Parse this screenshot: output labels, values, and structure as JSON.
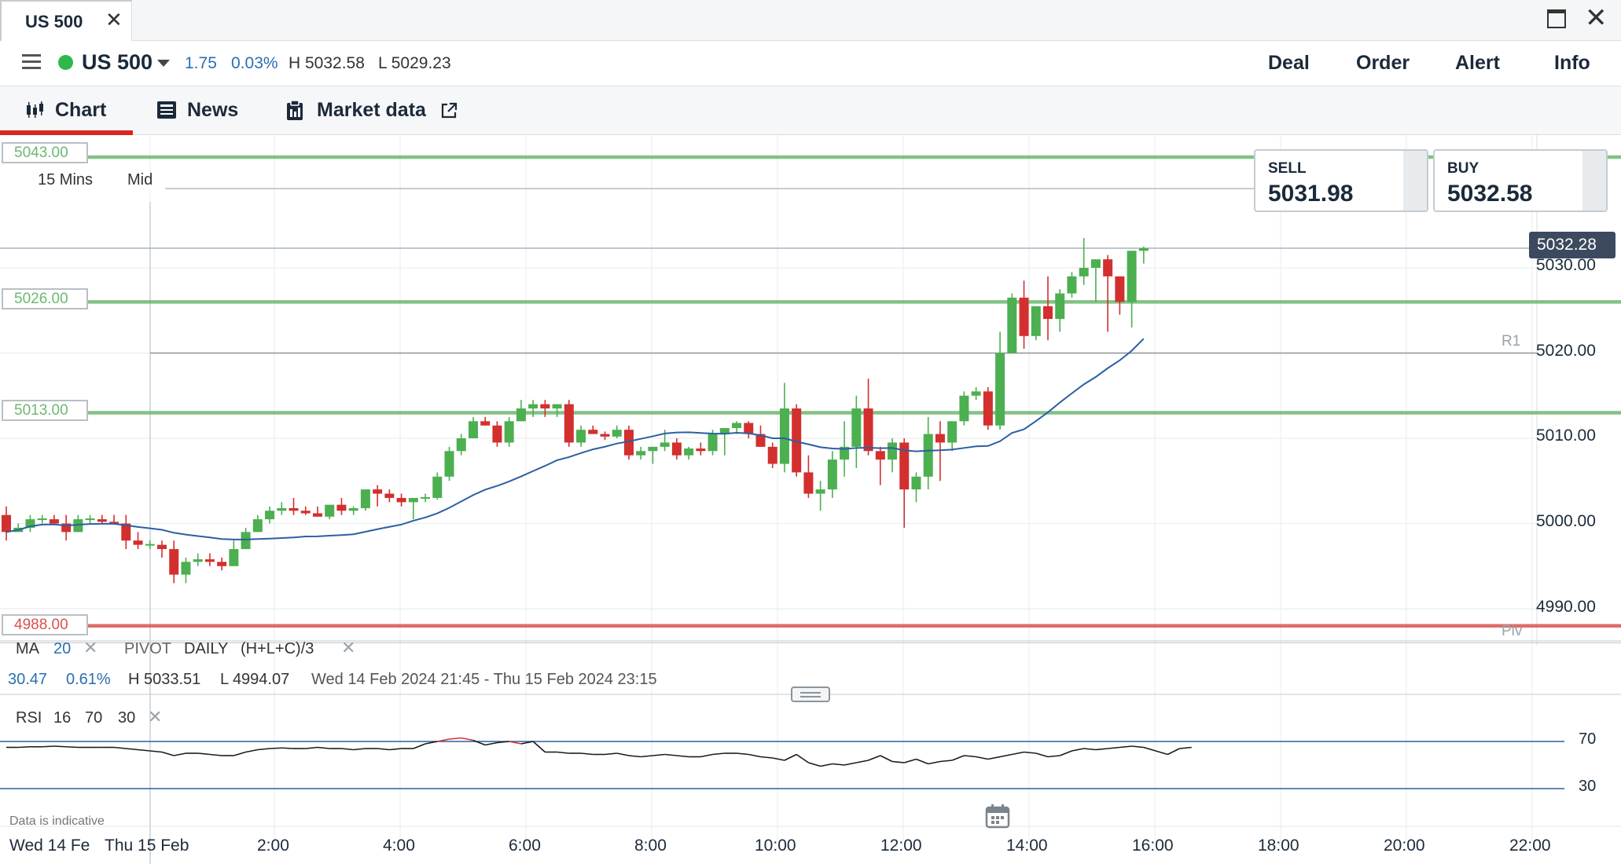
{
  "window": {
    "tab_title": "US 500"
  },
  "header": {
    "instrument": "US 500",
    "change": "1.75",
    "change_pct": "0.03%",
    "high": "H 5032.58",
    "low": "L 5029.23",
    "nav": [
      "Deal",
      "Order",
      "Alert",
      "Info"
    ]
  },
  "subtabs": {
    "chart": "Chart",
    "news": "News",
    "market_data": "Market data"
  },
  "chart": {
    "timeframe": "15 Mins",
    "price_type": "Mid",
    "levels": [
      {
        "label": "5043.00",
        "color": "#6db86f"
      },
      {
        "label": "5026.00",
        "color": "#6db86f"
      },
      {
        "label": "5013.00",
        "color": "#6db86f"
      },
      {
        "label": "4988.00",
        "color": "#d9534f"
      }
    ],
    "sell_label": "SELL",
    "sell_price": "5031.98",
    "buy_label": "BUY",
    "buy_price": "5032.58",
    "current_price": "5032.28",
    "y_axis": [
      "5030.00",
      "5020.00",
      "5010.00",
      "5000.00",
      "4990.00"
    ],
    "r1_label": "R1",
    "piv_label": "Piv",
    "x_axis": [
      "Wed 14 Fe",
      "Thu 15 Feb",
      "2:00",
      "4:00",
      "6:00",
      "8:00",
      "10:00",
      "12:00",
      "14:00",
      "16:00",
      "18:00",
      "20:00",
      "22:00"
    ],
    "indicator_legend": {
      "ma": "MA",
      "ma_period": "20",
      "pivot": "PIVOT",
      "pivot_period": "DAILY",
      "pivot_formula": "(H+L+C)/3"
    },
    "stats": {
      "change": "30.47",
      "change_pct": "0.61%",
      "high": "H 5033.51",
      "low": "L 4994.07",
      "range": "Wed 14 Feb 2024 21:45 - Thu 15 Feb 2024 23:15"
    },
    "rsi": {
      "label": "RSI",
      "period": "16",
      "upper": "70",
      "lower": "30",
      "axis": [
        "70",
        "30"
      ]
    },
    "disclaimer": "Data is indicative",
    "up_color": "#4caf50",
    "down_color": "#d32f2f"
  },
  "chart_data": {
    "type": "candlestick",
    "timeframe": "15 Mins",
    "ylim": [
      4986,
      5046
    ],
    "x_ticks": [
      "2:00",
      "4:00",
      "6:00",
      "8:00",
      "10:00",
      "12:00",
      "14:00",
      "16:00",
      "18:00",
      "20:00",
      "22:00"
    ],
    "candles_ohlc": [
      [
        5001,
        4998,
        5002,
        4999
      ],
      [
        4999,
        4999,
        5000,
        4999.5
      ],
      [
        4999.5,
        4999,
        5001,
        5000.5
      ],
      [
        5000.5,
        5000,
        5001,
        5000.5
      ],
      [
        5000.5,
        5000,
        5001,
        5000
      ],
      [
        5000,
        4998,
        5001,
        4999
      ],
      [
        4999,
        4999,
        5001,
        5000.5
      ],
      [
        5000.5,
        5000,
        5001,
        5000.5
      ],
      [
        5000.5,
        5000,
        5001,
        5000.2
      ],
      [
        5000.2,
        5000,
        5001,
        5000
      ],
      [
        5000,
        4997,
        5001,
        4998
      ],
      [
        4998,
        4997,
        4999,
        4997.5
      ],
      [
        4997.5,
        4997,
        4998,
        4997.5
      ],
      [
        4997.5,
        4996,
        4998,
        4997
      ],
      [
        4997,
        4993,
        4998,
        4994
      ],
      [
        4994,
        4993,
        4996,
        4995.5
      ],
      [
        4995.5,
        4995,
        4996.5,
        4995.8
      ],
      [
        4995.8,
        4995,
        4996.5,
        4995.5
      ],
      [
        4995.5,
        4994.5,
        4996,
        4995
      ],
      [
        4995,
        4995,
        4998,
        4997
      ],
      [
        4997,
        4997,
        4999.5,
        4999
      ],
      [
        4999,
        4999,
        5001,
        5000.5
      ],
      [
        5000.5,
        5000,
        5002,
        5001.5
      ],
      [
        5001.5,
        5001,
        5002.5,
        5001.8
      ],
      [
        5001.8,
        5001,
        5003,
        5001.5
      ],
      [
        5001.5,
        5001,
        5002,
        5001.2
      ],
      [
        5001.2,
        5001,
        5002,
        5000.8
      ],
      [
        5000.8,
        5000.5,
        5002,
        5002.2
      ],
      [
        5002.2,
        5001,
        5003,
        5001.5
      ],
      [
        5001.5,
        5001,
        5002,
        5001.8
      ],
      [
        5001.8,
        5001.5,
        5003.5,
        5004
      ],
      [
        5004,
        5002,
        5004.5,
        5003.5
      ],
      [
        5003.5,
        5002.5,
        5004,
        5003
      ],
      [
        5003,
        5002,
        5003.5,
        5002.5
      ],
      [
        5002.5,
        5000.5,
        5003,
        5003
      ],
      [
        5003,
        5002.5,
        5003.5,
        5003
      ],
      [
        5003,
        5002.8,
        5006,
        5005.5
      ],
      [
        5005.5,
        5005,
        5009,
        5008.5
      ],
      [
        5008.5,
        5008,
        5010.5,
        5010
      ],
      [
        5010,
        5010,
        5012.5,
        5012
      ],
      [
        5012,
        5011.5,
        5012.5,
        5011.5
      ],
      [
        5011.5,
        5009,
        5012,
        5009.5
      ],
      [
        5009.5,
        5009,
        5012.5,
        5012
      ],
      [
        5012,
        5012,
        5014.5,
        5013.5
      ],
      [
        5013.5,
        5012.5,
        5014.5,
        5014
      ],
      [
        5014,
        5012.5,
        5014.5,
        5013.5
      ],
      [
        5013.5,
        5012.5,
        5014,
        5014
      ],
      [
        5014,
        5009,
        5014.5,
        5009.5
      ],
      [
        5009.5,
        5009,
        5011.5,
        5011
      ],
      [
        5011,
        5010.5,
        5011.5,
        5010.5
      ],
      [
        5010.5,
        5009.8,
        5010.8,
        5010.2
      ],
      [
        5010.2,
        5010,
        5011.5,
        5011
      ],
      [
        5011,
        5007.5,
        5011.5,
        5008
      ],
      [
        5008,
        5007.5,
        5009,
        5008.5
      ],
      [
        5008.5,
        5007,
        5009,
        5009
      ],
      [
        5009,
        5008.5,
        5011,
        5009.5
      ],
      [
        5009.5,
        5007.5,
        5010,
        5008
      ],
      [
        5008,
        5007.5,
        5009,
        5008.8
      ],
      [
        5008.8,
        5008,
        5009.5,
        5008.5
      ],
      [
        5008.5,
        5008,
        5011,
        5010.5
      ],
      [
        5010.5,
        5008,
        5011,
        5011.2
      ],
      [
        5011.2,
        5010.5,
        5012,
        5011.8
      ],
      [
        5011.8,
        5010,
        5012,
        5010.5
      ],
      [
        5010.5,
        5009,
        5011.5,
        5009
      ],
      [
        5009,
        5006.5,
        5009.5,
        5007
      ],
      [
        5007,
        5006,
        5016.5,
        5013.5
      ],
      [
        5013.5,
        5005.5,
        5014,
        5006
      ],
      [
        5006,
        5003,
        5008,
        5003.5
      ],
      [
        5003.5,
        5001.5,
        5005,
        5004
      ],
      [
        5004,
        5003,
        5008.5,
        5007.5
      ],
      [
        5007.5,
        5005.5,
        5012,
        5009
      ],
      [
        5009,
        5006.5,
        5015,
        5013.5
      ],
      [
        5013.5,
        5008,
        5017,
        5008.5
      ],
      [
        5008.5,
        5004.5,
        5009,
        5007.5
      ],
      [
        5007.5,
        5006,
        5010,
        5009.5
      ],
      [
        5009.5,
        4999.5,
        5010,
        5004
      ],
      [
        5004,
        5002.5,
        5006,
        5005.5
      ],
      [
        5005.5,
        5004,
        5012.5,
        5010.5
      ],
      [
        5010.5,
        5005,
        5012,
        5009.5
      ],
      [
        5009.5,
        5008.5,
        5012,
        5012
      ],
      [
        5012,
        5011.5,
        5015.5,
        5015
      ],
      [
        5015,
        5014.5,
        5016,
        5015.5
      ],
      [
        5015.5,
        5011,
        5016,
        5011.5
      ],
      [
        5011.5,
        5011,
        5022.5,
        5020
      ],
      [
        5020,
        5020,
        5027,
        5026.5
      ],
      [
        5026.5,
        5020.5,
        5028.5,
        5022
      ],
      [
        5022,
        5021.5,
        5025.5,
        5025.5
      ],
      [
        5025.5,
        5021.5,
        5029,
        5024
      ],
      [
        5024,
        5022.5,
        5027.5,
        5027
      ],
      [
        5027,
        5026.5,
        5029.5,
        5029
      ],
      [
        5029,
        5028,
        5033.5,
        5030
      ],
      [
        5030,
        5026,
        5031,
        5031
      ],
      [
        5031,
        5022.5,
        5031.5,
        5029
      ],
      [
        5029,
        5024.5,
        5028.5,
        5026
      ],
      [
        5026,
        5023,
        5032,
        5032
      ],
      [
        5032,
        5030.5,
        5032.5,
        5032.3
      ]
    ],
    "ma_period": 20,
    "levels": [
      5043.0,
      5026.0,
      5013.0,
      4988.0
    ],
    "rsi": [
      65,
      65,
      65.5,
      65.5,
      66,
      65.5,
      65,
      65,
      65,
      65,
      64,
      63,
      62,
      61,
      58,
      60,
      60,
      59,
      58,
      58,
      61,
      63,
      64,
      64.5,
      64,
      64,
      65,
      64,
      64,
      63,
      64,
      64,
      63,
      64,
      64,
      68,
      70,
      72,
      73,
      71,
      67,
      69,
      70,
      68,
      70,
      61,
      61,
      60,
      60,
      59,
      59,
      60,
      58,
      57,
      58,
      59,
      58,
      57,
      57,
      59,
      60,
      60,
      59,
      57,
      56,
      54,
      59,
      52,
      49,
      51,
      50,
      52,
      54,
      58,
      53,
      52,
      55,
      51,
      53,
      54,
      58,
      57,
      55,
      57,
      59,
      61,
      60,
      57,
      58,
      62,
      64,
      63,
      64,
      65,
      66,
      65,
      62,
      59,
      64,
      65
    ],
    "series": [
      {
        "name": "MA",
        "type": "line"
      },
      {
        "name": "RSI",
        "type": "line"
      }
    ]
  }
}
